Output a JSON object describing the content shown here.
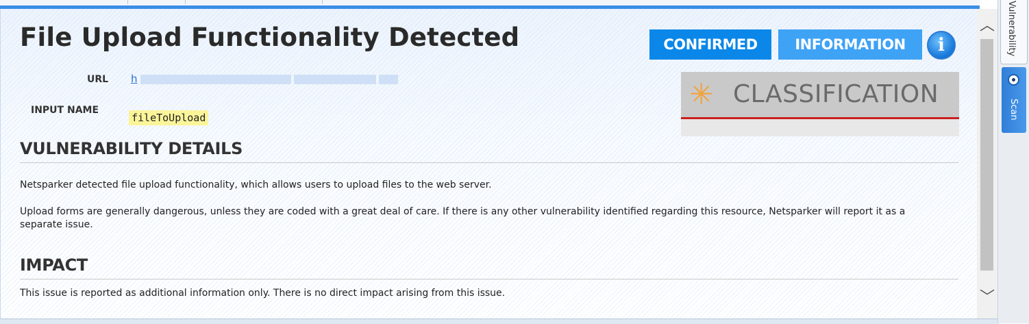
{
  "issue": {
    "title": "File Upload Functionality Detected",
    "url_label": "URL",
    "url_visible_prefix": "h",
    "input_name_label": "INPUT NAME",
    "input_name_value": "fileToUpload"
  },
  "badges": {
    "confirmed": "CONFIRMED",
    "severity": "INFORMATION",
    "info_icon_glyph": "i"
  },
  "classification": {
    "label": "CLASSIFICATION",
    "icon": "asterisk-icon",
    "icon_glyph": "✳"
  },
  "sections": {
    "details_heading": "VULNERABILITY DETAILS",
    "details_p1": "Netsparker detected file upload functionality, which allows users to upload files to the web server.",
    "details_p2": "Upload forms are generally dangerous, unless they are coded with a great deal of care. If there is any other vulnerability identified regarding this resource, Netsparker will report it as a separate issue.",
    "impact_heading": "IMPACT",
    "impact_p1": "This issue is reported as additional information only. There is no direct impact arising from this issue."
  },
  "side_tabs": {
    "vulnerability": "Vulnerability",
    "scan": "Scan"
  },
  "scrollbar": {
    "up_glyph": "︿",
    "down_glyph": "﹀"
  },
  "colors": {
    "confirmed_badge": "#0a87e8",
    "information_badge": "#3ea2f5",
    "classification_accent": "#cc1f1f",
    "classification_star": "#f2a33b",
    "input_highlight": "#fbf59a",
    "link": "#2b6fd6"
  }
}
